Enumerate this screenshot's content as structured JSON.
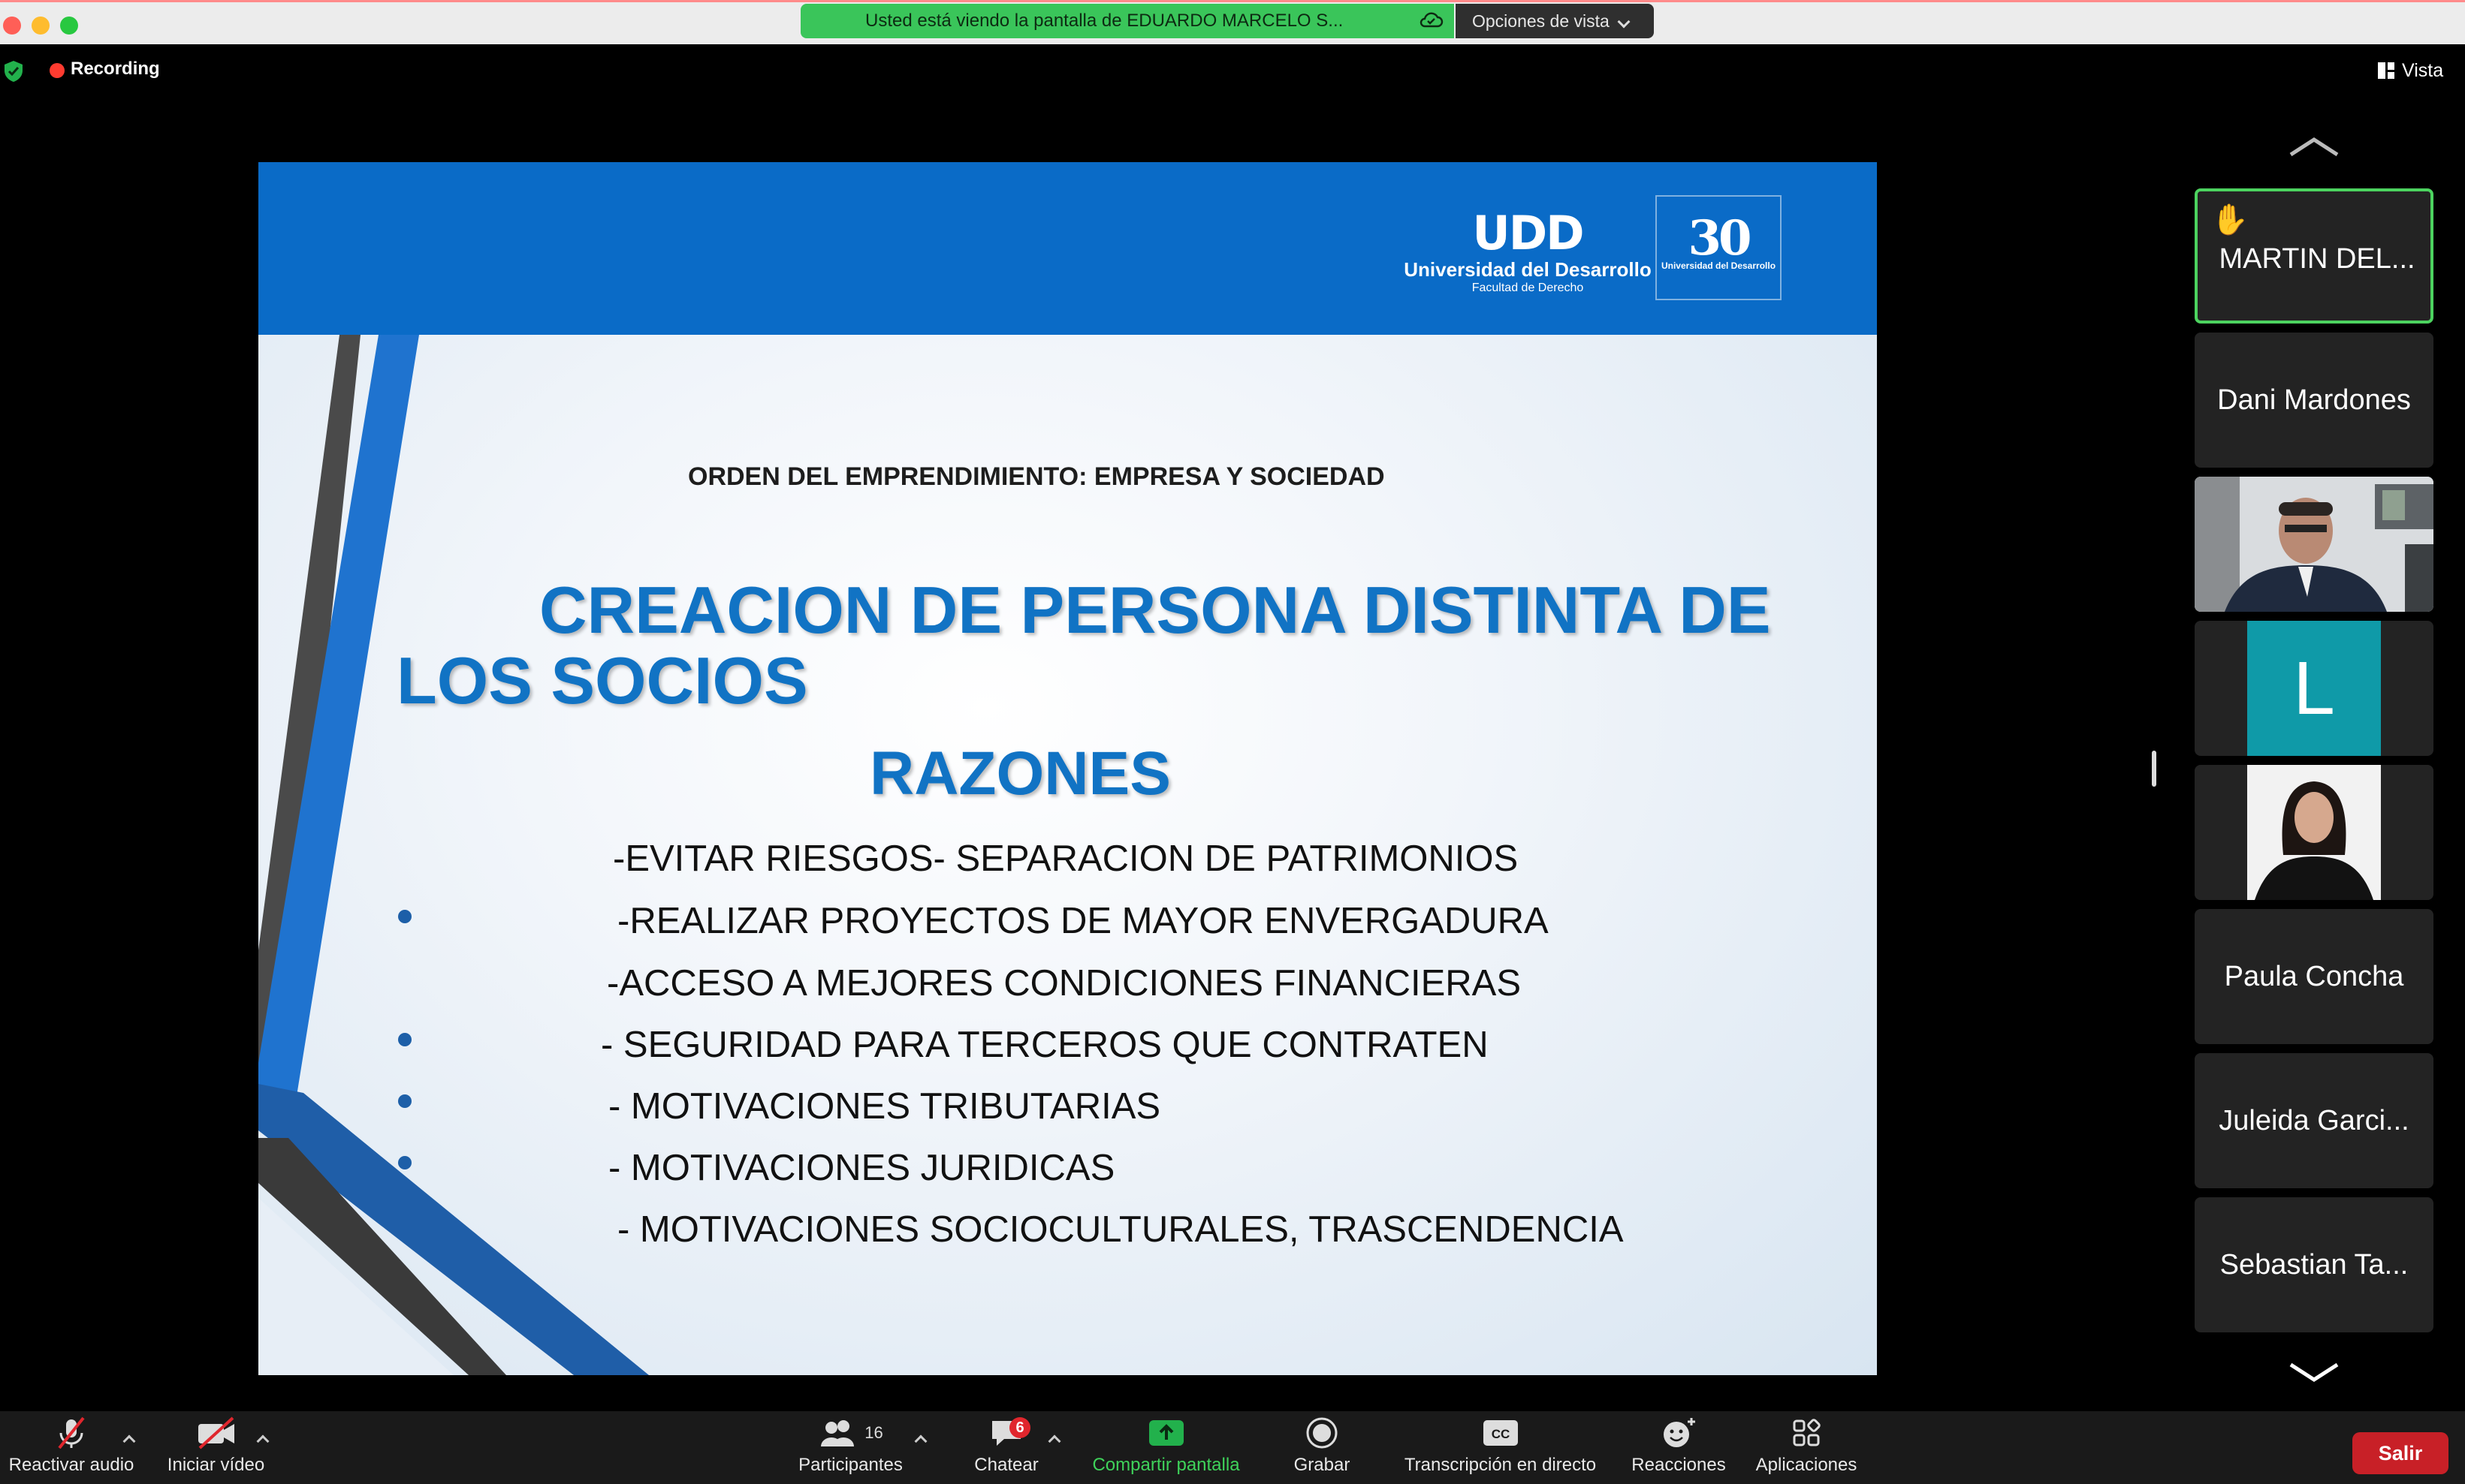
{
  "banner": {
    "sharing_text": "Usted está viendo la pantalla de EDUARDO MARCELO S...",
    "view_options": "Opciones de vista"
  },
  "topbar": {
    "recording": "Recording",
    "view": "Vista"
  },
  "slide": {
    "logo_mark": "UDD",
    "logo_name": "Universidad del Desarrollo",
    "logo_faculty": "Facultad de Derecho",
    "anniversary_mark": "30",
    "anniversary_text": "Universidad del Desarrollo",
    "subtitle": "ORDEN DEL EMPRENDIMIENTO: EMPRESA Y SOCIEDAD",
    "title_line1": "CREACION DE PERSONA DISTINTA DE",
    "title_line2": "LOS SOCIOS",
    "heading": "RAZONES",
    "reasons": [
      "-EVITAR RIESGOS- SEPARACION DE PATRIMONIOS",
      "-REALIZAR PROYECTOS DE MAYOR ENVERGADURA",
      "-ACCESO A MEJORES CONDICIONES FINANCIERAS",
      "- SEGURIDAD PARA TERCEROS QUE CONTRATEN",
      "- MOTIVACIONES TRIBUTARIAS",
      "- MOTIVACIONES JURIDICAS",
      "- MOTIVACIONES SOCIOCULTURALES, TRASCENDENCIA"
    ]
  },
  "participants": [
    {
      "name": "MARTIN DEL...",
      "hand_raised": true,
      "active": true
    },
    {
      "name": "Dani Mardones"
    },
    {
      "name": "",
      "video": true
    },
    {
      "name": "",
      "avatar_letter": "L"
    },
    {
      "name": "",
      "video": true
    },
    {
      "name": "Paula Concha"
    },
    {
      "name": "Juleida Garci..."
    },
    {
      "name": "Sebastian Ta..."
    }
  ],
  "toolbar": {
    "unmute": "Reactivar audio",
    "start_video": "Iniciar vídeo",
    "participants": "Participantes",
    "participants_count": "16",
    "chat": "Chatear",
    "chat_badge": "6",
    "share": "Compartir pantalla",
    "record": "Grabar",
    "transcription": "Transcripción en directo",
    "reactions": "Reacciones",
    "apps": "Aplicaciones",
    "leave": "Salir",
    "share_color": "#3fd25a",
    "leave_color": "#c82027"
  }
}
